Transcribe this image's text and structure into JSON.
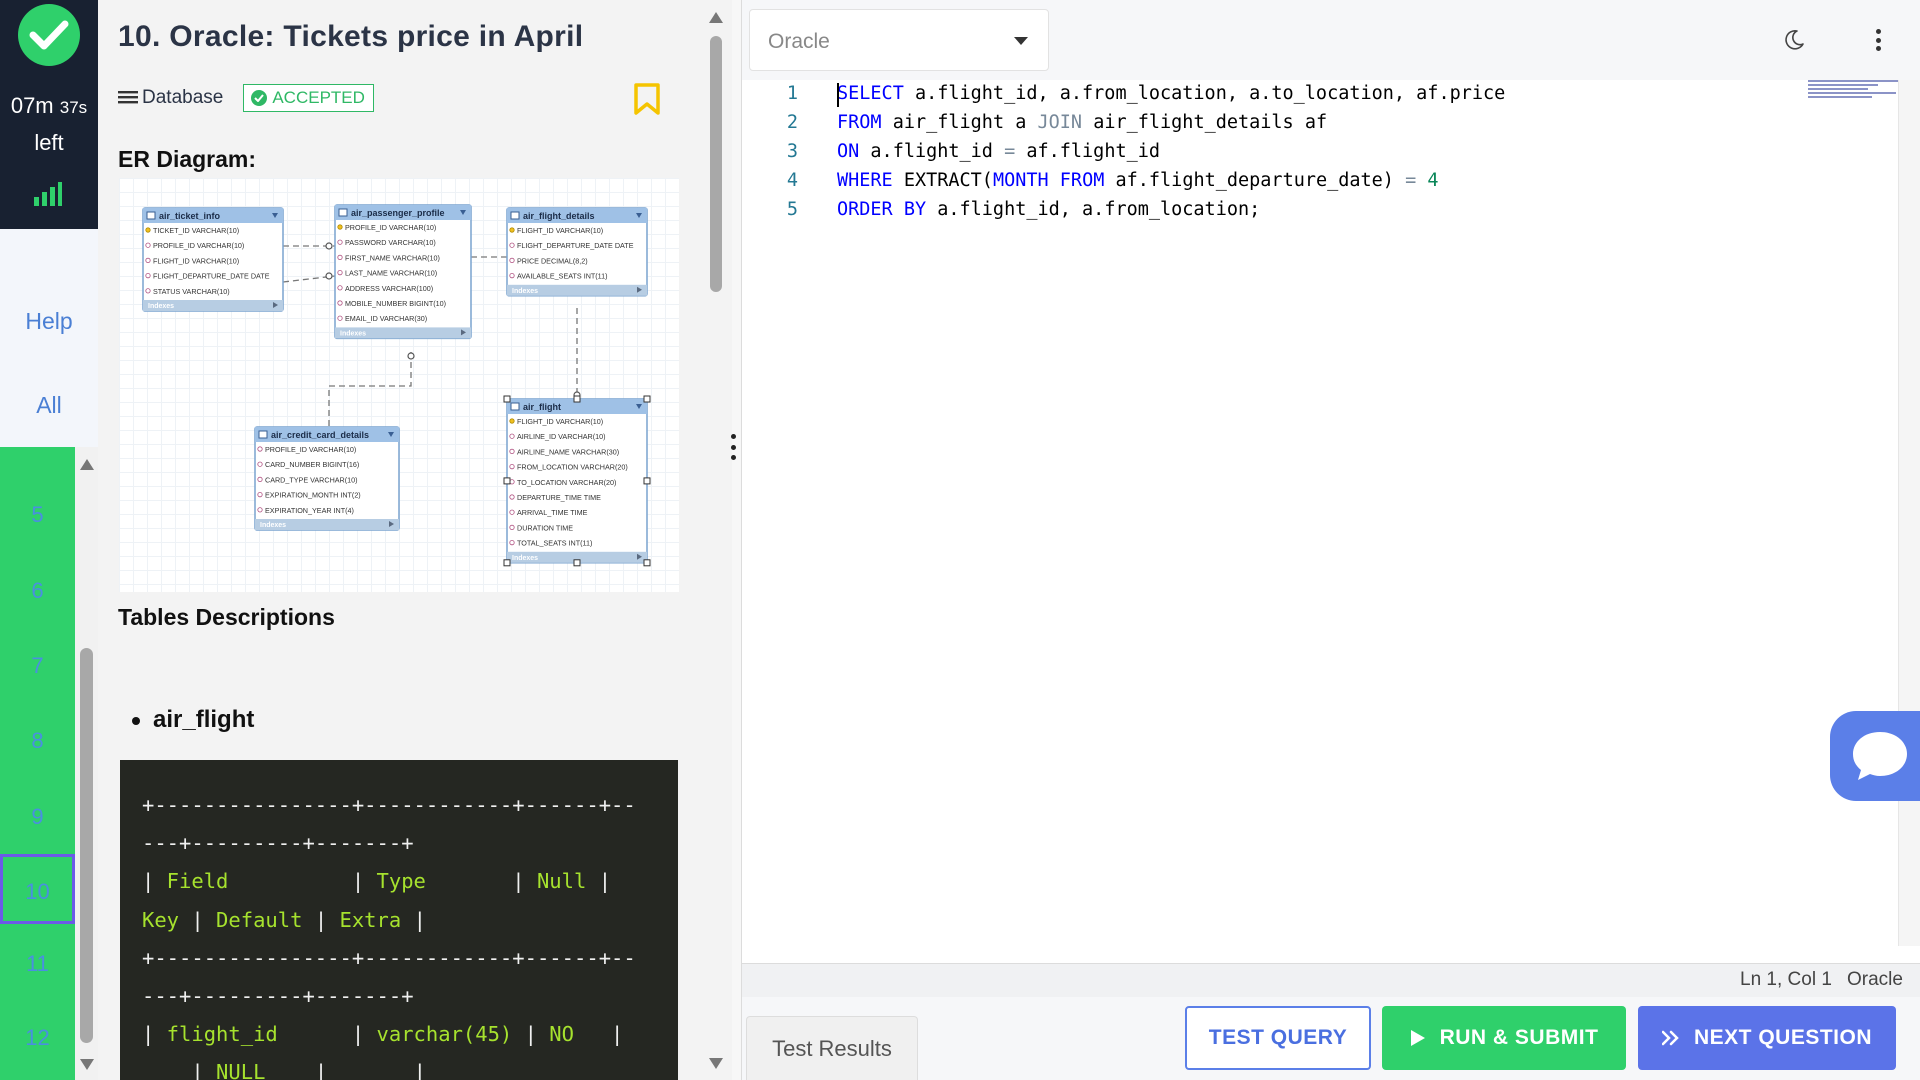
{
  "timer": {
    "minutes": "07m",
    "seconds": "37s",
    "suffix": "left"
  },
  "nav": {
    "help": "Help",
    "all": "All"
  },
  "questions": [
    "5",
    "6",
    "7",
    "8",
    "9",
    "10",
    "11",
    "12"
  ],
  "active_question": "10",
  "problem": {
    "title": "10. Oracle: Tickets price in April",
    "category": "Database",
    "status": "ACCEPTED",
    "er_heading": "ER Diagram:",
    "tables_heading": "Tables Descriptions",
    "bullet": "air_flight",
    "code_lines": [
      "+----------------+------------+------+--",
      "---+---------+-------+",
      "| Field          | Type       | Null |",
      "Key | Default | Extra |",
      "+----------------+------------+------+--",
      "---+---------+-------+",
      "| flight_id      | varchar(45) | NO   |",
      "    | NULL    |       |"
    ]
  },
  "er": {
    "tables": [
      {
        "name": "air_ticket_info",
        "cols": [
          "TICKET_ID VARCHAR(10)",
          "PROFILE_ID VARCHAR(10)",
          "FLIGHT_ID VARCHAR(10)",
          "FLIGHT_DEPARTURE_DATE DATE",
          "STATUS VARCHAR(10)"
        ]
      },
      {
        "name": "air_passenger_profile",
        "cols": [
          "PROFILE_ID VARCHAR(10)",
          "PASSWORD VARCHAR(10)",
          "FIRST_NAME VARCHAR(10)",
          "LAST_NAME VARCHAR(10)",
          "ADDRESS VARCHAR(100)",
          "MOBILE_NUMBER BIGINT(10)",
          "EMAIL_ID VARCHAR(30)"
        ]
      },
      {
        "name": "air_flight_details",
        "cols": [
          "FLIGHT_ID VARCHAR(10)",
          "FLIGHT_DEPARTURE_DATE DATE",
          "PRICE DECIMAL(8,2)",
          "AVAILABLE_SEATS INT(11)"
        ]
      },
      {
        "name": "air_credit_card_details",
        "cols": [
          "PROFILE_ID VARCHAR(10)",
          "CARD_NUMBER BIGINT(16)",
          "CARD_TYPE VARCHAR(10)",
          "EXPIRATION_MONTH INT(2)",
          "EXPIRATION_YEAR INT(4)"
        ]
      },
      {
        "name": "air_flight",
        "cols": [
          "FLIGHT_ID VARCHAR(10)",
          "AIRLINE_ID VARCHAR(10)",
          "AIRLINE_NAME VARCHAR(30)",
          "FROM_LOCATION VARCHAR(20)",
          "TO_LOCATION VARCHAR(20)",
          "DEPARTURE_TIME TIME",
          "ARRIVAL_TIME TIME",
          "DURATION TIME",
          "TOTAL_SEATS INT(11)"
        ]
      }
    ],
    "indexes_label": "Indexes"
  },
  "editor": {
    "dialect": "Oracle",
    "line_numbers": [
      "1",
      "2",
      "3",
      "4",
      "5"
    ],
    "lines": [
      [
        [
          "kw",
          "SELECT"
        ],
        [
          "t",
          " a.flight_id, a.from_location, a.to_location, af.price"
        ]
      ],
      [
        [
          "kw",
          "FROM"
        ],
        [
          "t",
          " air_flight a "
        ],
        [
          "op",
          "JOIN"
        ],
        [
          "t",
          " air_flight_details af"
        ]
      ],
      [
        [
          "kw",
          "ON"
        ],
        [
          "t",
          " a.flight_id "
        ],
        [
          "op",
          "="
        ],
        [
          "t",
          " af.flight_id"
        ]
      ],
      [
        [
          "kw",
          "WHERE"
        ],
        [
          "t",
          " EXTRACT("
        ],
        [
          "kw",
          "MONTH"
        ],
        [
          "t",
          " "
        ],
        [
          "kw",
          "FROM"
        ],
        [
          "t",
          " af.flight_departure_date) "
        ],
        [
          "op",
          "="
        ],
        [
          "t",
          " "
        ],
        [
          "num",
          "4"
        ]
      ],
      [
        [
          "kw",
          "ORDER BY"
        ],
        [
          "t",
          " a.flight_id, a.from_location;"
        ]
      ]
    ]
  },
  "statusbar": {
    "position": "Ln 1, Col 1",
    "dialect": "Oracle"
  },
  "bottom": {
    "tab": "Test Results",
    "test": "TEST QUERY",
    "run": "RUN & SUBMIT",
    "next": "NEXT QUESTION"
  },
  "colors": {
    "success": "#2fd06b",
    "primary": "#5b73e8",
    "rail_dark": "#182131"
  }
}
